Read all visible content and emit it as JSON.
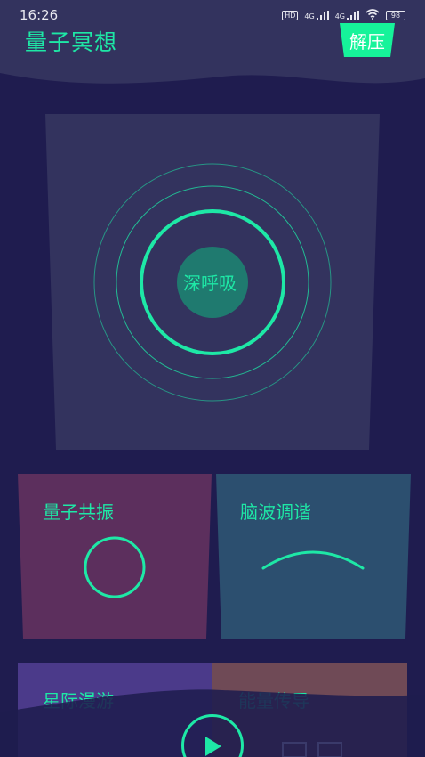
{
  "status": {
    "time": "16:26",
    "icons": [
      "hd-icon",
      "signal-4g-icon",
      "signal-4g-icon",
      "wifi-icon",
      "battery-icon"
    ],
    "hd": "HD",
    "net1": "4G",
    "net2": "4G",
    "battery": "98"
  },
  "header": {
    "title": "量子冥想",
    "relax_label": "解压"
  },
  "breath": {
    "label": "深呼吸"
  },
  "tiles": [
    {
      "label": "量子共振",
      "color": "#5c2f5d"
    },
    {
      "label": "脑波调谐",
      "color": "#2c4f6f"
    },
    {
      "label": "星际漫游",
      "color": "#4b3a8a"
    },
    {
      "label": "能量传导",
      "color": "#6f4a56"
    }
  ],
  "colors": {
    "background": "#1f1c4f",
    "card": "#33335e",
    "accent": "#1ee8a6",
    "button": "#16f39a"
  }
}
